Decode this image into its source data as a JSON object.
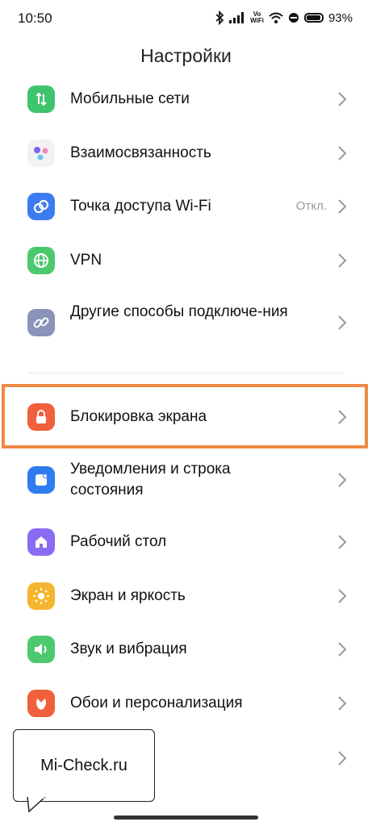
{
  "status_bar": {
    "time": "10:50",
    "battery": "93%"
  },
  "title": "Настройки",
  "items": [
    {
      "label": "Мобильные сети",
      "icon": "mobile-data-icon"
    },
    {
      "label": "Взаимосвязанность",
      "icon": "interconnectivity-icon"
    },
    {
      "label": "Точка доступа Wi-Fi",
      "icon": "hotspot-icon",
      "status": "Откл."
    },
    {
      "label": "VPN",
      "icon": "vpn-globe-icon"
    },
    {
      "label": "Другие способы подключе-ния",
      "icon": "link-icon"
    },
    {
      "label": "Блокировка экрана",
      "icon": "lock-icon"
    },
    {
      "label": "Уведомления и строка состояния",
      "icon": "notifications-icon"
    },
    {
      "label": "Рабочий стол",
      "icon": "home-icon"
    },
    {
      "label": "Экран и яркость",
      "icon": "brightness-icon"
    },
    {
      "label": "Звук и вибрация",
      "icon": "speaker-icon"
    },
    {
      "label": "Обои и персонализация",
      "icon": "wallpaper-icon"
    }
  ],
  "watermark": "Mi-Check.ru",
  "colors": {
    "accent_highlight": "#ee8a45",
    "mobile": "#3ec46d",
    "hotspot": "#3b7df1",
    "vpn": "#4cc96e",
    "link": "#8a93b8",
    "lock": "#f0603c",
    "notifications": "#2f7cf0",
    "home": "#8a6cf2",
    "brightness": "#f6b52e",
    "sound": "#4cc96e",
    "wallpaper": "#f0603c"
  }
}
